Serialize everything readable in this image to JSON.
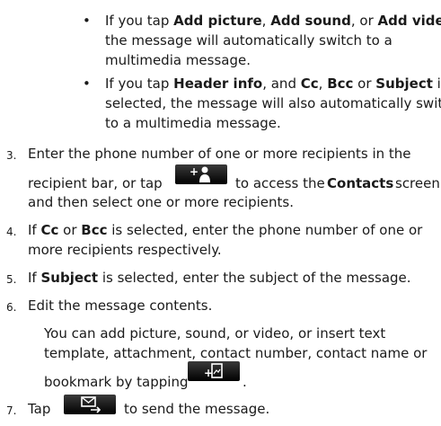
{
  "bullets": [
    {
      "lines": [
        [
          "If you tap ",
          {
            "b": "Add picture"
          },
          ", ",
          {
            "b": "Add sound"
          },
          ", or ",
          {
            "b": "Add video"
          },
          ","
        ],
        [
          "the message will automatically switch to a"
        ],
        [
          "multimedia message."
        ]
      ]
    },
    {
      "lines": [
        [
          "If you tap ",
          {
            "b": "Header info"
          },
          ", and ",
          {
            "b": "Cc"
          },
          ", ",
          {
            "b": "Bcc"
          },
          " or ",
          {
            "b": "Subject"
          },
          " is"
        ],
        [
          "selected, the message will also automatically switch"
        ],
        [
          "to a multimedia message."
        ]
      ]
    }
  ],
  "steps": {
    "s3": {
      "num": "3.",
      "line1": "Enter the phone number of one or more recipients in the",
      "line2a": "recipient bar, or tap",
      "line2b": "to access the",
      "line2c": "Contacts",
      "line2d": "screen",
      "line3": "and then select one or more recipients."
    },
    "s4": {
      "num": "4.",
      "line1": [
        "If ",
        {
          "b": "Cc"
        },
        " or ",
        {
          "b": "Bcc"
        },
        " is selected, enter the phone number of one or"
      ],
      "line2": "more recipients respectively."
    },
    "s5": {
      "num": "5.",
      "line1": [
        "If ",
        {
          "b": "Subject"
        },
        " is selected, enter the subject of the message."
      ]
    },
    "s6": {
      "num": "6.",
      "line1": "Edit the message contents.",
      "p1": "You can add picture, sound, or video, or insert text",
      "p2": "template, attachment, contact number, contact name or",
      "p3": "bookmark by tapping",
      "p3end": "."
    },
    "s7": {
      "num": "7.",
      "tap": "Tap",
      "rest": "to send the message."
    }
  },
  "icons": {
    "add_contact_button": "add-contact-icon",
    "insert_button": "insert-icon",
    "send_button": "send-icon"
  }
}
